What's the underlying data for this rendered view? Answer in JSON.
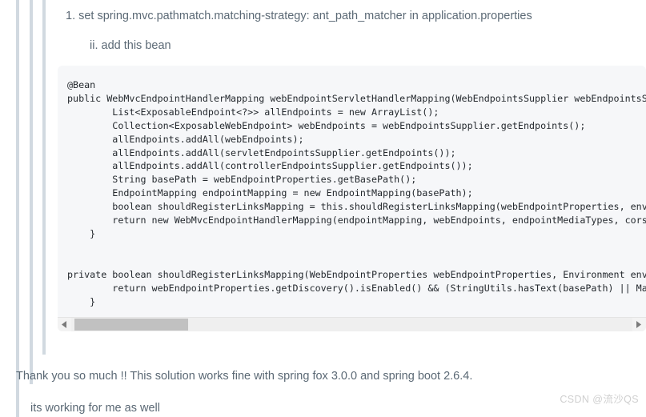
{
  "answer": {
    "steps": {
      "primary": "1. set spring.mvc.pathmatch.matching-strategy: ant_path_matcher in application.properties",
      "secondary": "ii. add this bean"
    },
    "code_block": {
      "language": "java",
      "content": "@Bean\npublic WebMvcEndpointHandlerMapping webEndpointServletHandlerMapping(WebEndpointsSupplier webEndpointsSupp\n        List<ExposableEndpoint<?>> allEndpoints = new ArrayList();\n        Collection<ExposableWebEndpoint> webEndpoints = webEndpointsSupplier.getEndpoints();\n        allEndpoints.addAll(webEndpoints);\n        allEndpoints.addAll(servletEndpointsSupplier.getEndpoints());\n        allEndpoints.addAll(controllerEndpointsSupplier.getEndpoints());\n        String basePath = webEndpointProperties.getBasePath();\n        EndpointMapping endpointMapping = new EndpointMapping(basePath);\n        boolean shouldRegisterLinksMapping = this.shouldRegisterLinksMapping(webEndpointProperties, enviro\n        return new WebMvcEndpointHandlerMapping(endpointMapping, webEndpoints, endpointMediaTypes, corsPro\n    }\n\n\nprivate boolean shouldRegisterLinksMapping(WebEndpointProperties webEndpointProperties, Environment enviro\n        return webEndpointProperties.getDiscovery().isEnabled() && (StringUtils.hasText(basePath) || Manag\n    }",
      "scrollbar": {
        "left_arrow": "scroll-left-arrow",
        "right_arrow": "scroll-right-arrow",
        "thumb_position_percent": 0,
        "thumb_width_percent": 20
      }
    },
    "comments": [
      "Thank you so much !! This solution works fine with spring fox 3.0.0 and spring boot 2.6.4.",
      "its working for me as well"
    ]
  },
  "watermark": {
    "text": "CSDN @流沙QS"
  },
  "colors": {
    "quote_bar": "#d1d9e0",
    "code_background": "#f6f7f9",
    "text": "#5b6975",
    "code_text": "#24292e",
    "scrollbar_thumb": "#c1c1c1",
    "watermark": "#cfcfcf"
  }
}
